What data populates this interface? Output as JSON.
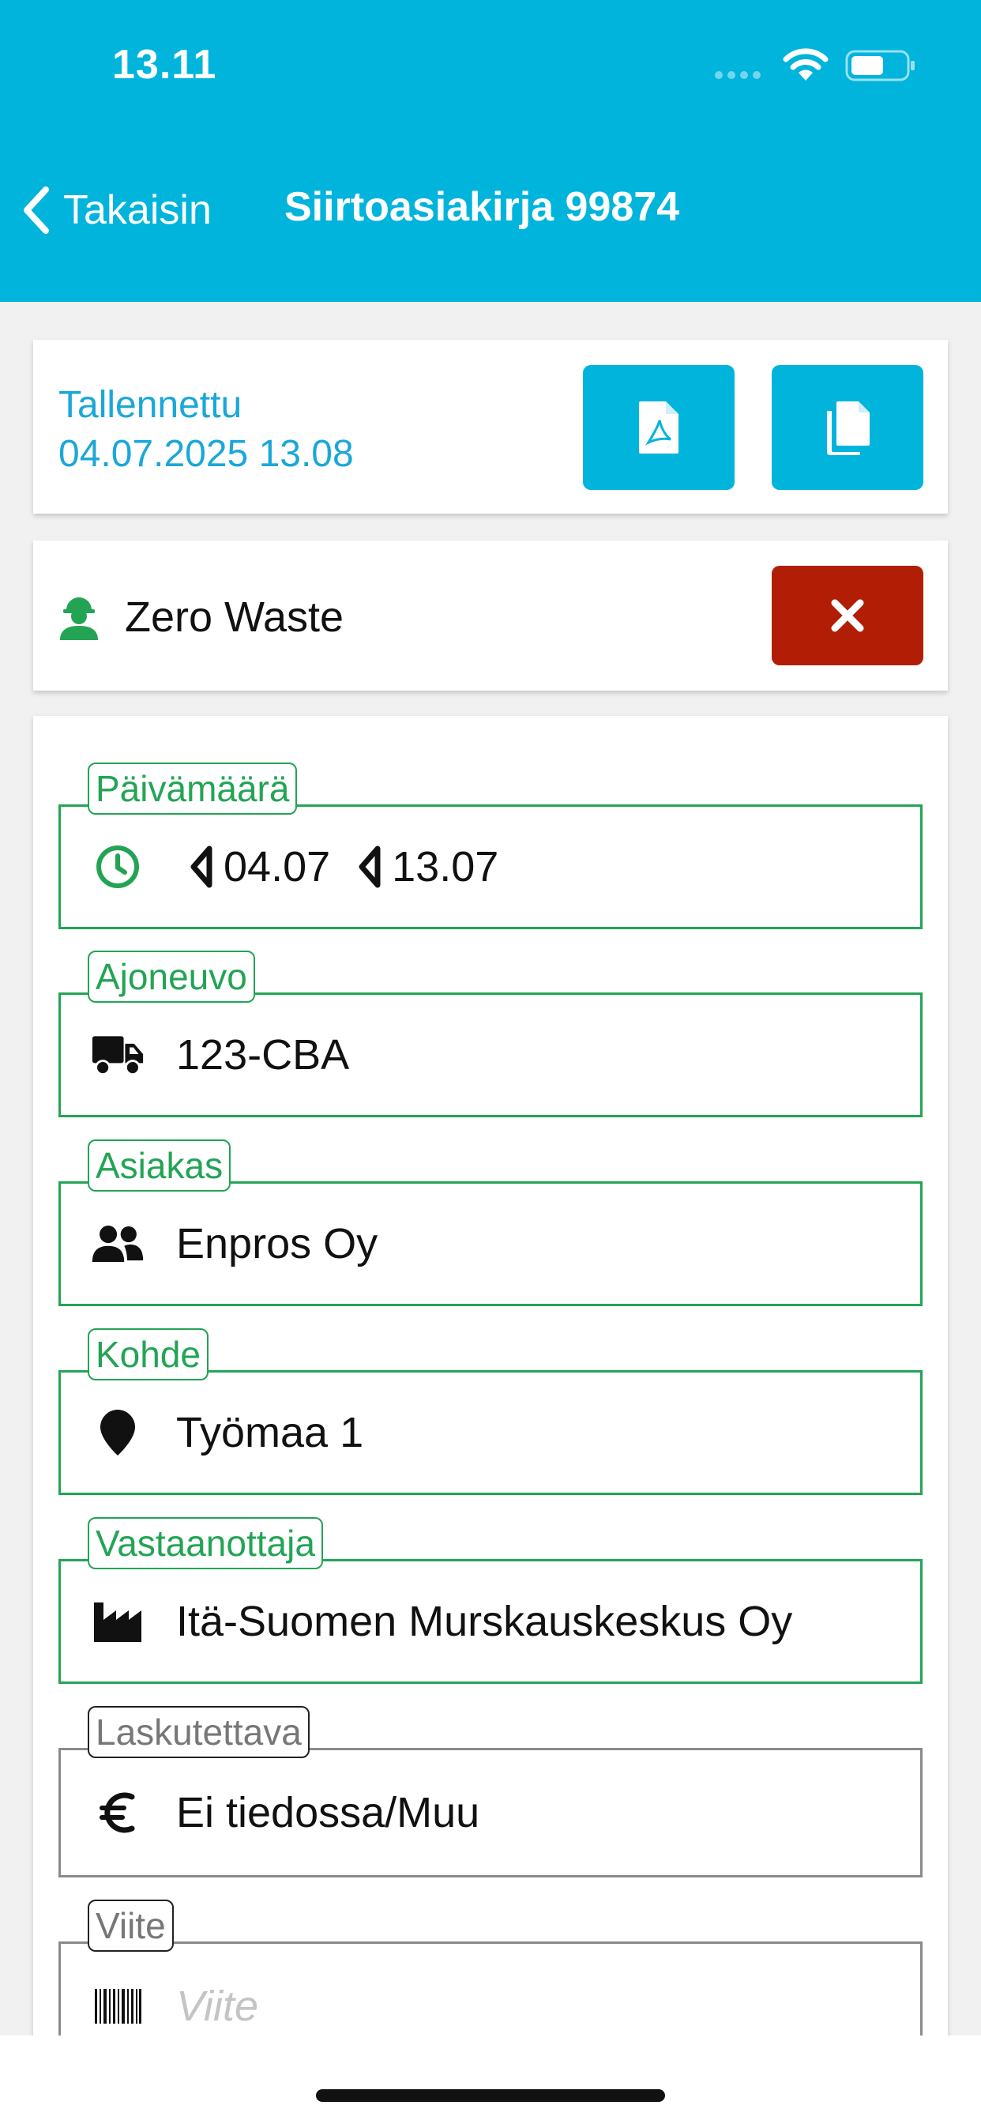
{
  "status_bar": {
    "time": "13.11"
  },
  "header": {
    "back_label": "Takaisin",
    "title": "Siirtoasiakirja 99874"
  },
  "saved": {
    "label": "Tallennettu",
    "datetime": "04.07.2025 13.08"
  },
  "driver": {
    "name": "Zero Waste"
  },
  "form": {
    "date": {
      "label": "Päivämäärä",
      "date_part": "04.07",
      "time_part": "13.07"
    },
    "vehicle": {
      "label": "Ajoneuvo",
      "value": "123-CBA"
    },
    "customer": {
      "label": "Asiakas",
      "value": "Enpros Oy"
    },
    "site": {
      "label": "Kohde",
      "value": "Työmaa 1"
    },
    "receiver": {
      "label": "Vastaanottaja",
      "value": "Itä-Suomen Murskauskeskus Oy"
    },
    "billing": {
      "label": "Laskutettava",
      "value": "Ei tiedossa/Muu"
    },
    "reference": {
      "label": "Viite",
      "placeholder": "Viite"
    }
  },
  "icons": {
    "date": "clock-icon",
    "vehicle": "truck-icon",
    "customer": "users-icon",
    "site": "map-marker-icon",
    "receiver": "industry-icon",
    "billing": "euro-icon",
    "reference": "barcode-icon",
    "driver": "hard-hat-worker-icon"
  },
  "colors": {
    "brand": "#00b4dc",
    "success_border": "#23a455",
    "danger": "#b11e05",
    "saved_text": "#1ba7d8"
  }
}
